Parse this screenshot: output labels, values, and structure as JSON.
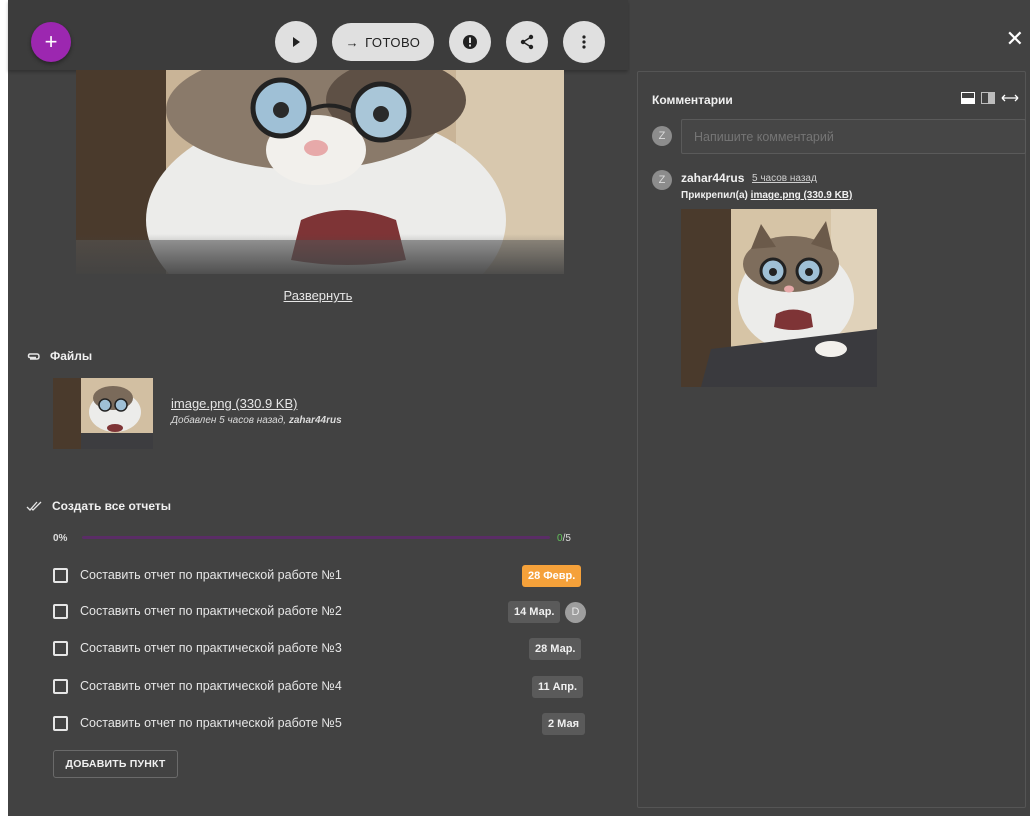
{
  "toolbar": {
    "add_label": "+",
    "done_label": "ГОТОВО",
    "done_arrow": "→"
  },
  "description": {
    "expand_label": "Развернуть"
  },
  "files": {
    "title": "Файлы",
    "items": [
      {
        "name": "image.png (330.9 KB)",
        "meta_prefix": "Добавлен 5 часов назад, ",
        "meta_user": "zahar44rus"
      }
    ]
  },
  "checklist": {
    "title": "Создать все отчеты",
    "progress_percent": "0%",
    "progress_done": "0",
    "progress_total": "/5",
    "progress_fraction": 0,
    "items": [
      {
        "label": "Составить отчет по практической работе №1",
        "date": "28 Февр.",
        "overdue": true
      },
      {
        "label": "Составить отчет по практической работе №2",
        "date": "14 Мар.",
        "assignee": "D"
      },
      {
        "label": "Составить отчет по практической работе №3",
        "date": "28 Мар."
      },
      {
        "label": "Составить отчет по практической работе №4",
        "date": "11 Апр."
      },
      {
        "label": "Составить отчет по практической работе №5",
        "date": "2 Мая"
      }
    ],
    "add_item_label": "ДОБАВИТЬ ПУНКТ"
  },
  "comments": {
    "title": "Комментарии",
    "input_placeholder": "Напишите комментарий",
    "current_user_initial": "Z",
    "entries": [
      {
        "author": "zahar44rus",
        "author_initial": "Z",
        "time": "5 часов назад",
        "attach_prefix": "Прикрепил(а) ",
        "attachment": "image.png (330.9 KB)"
      }
    ]
  },
  "colors": {
    "accent": "#9c27b0",
    "overdue": "#f5a13a",
    "background": "#424242"
  }
}
